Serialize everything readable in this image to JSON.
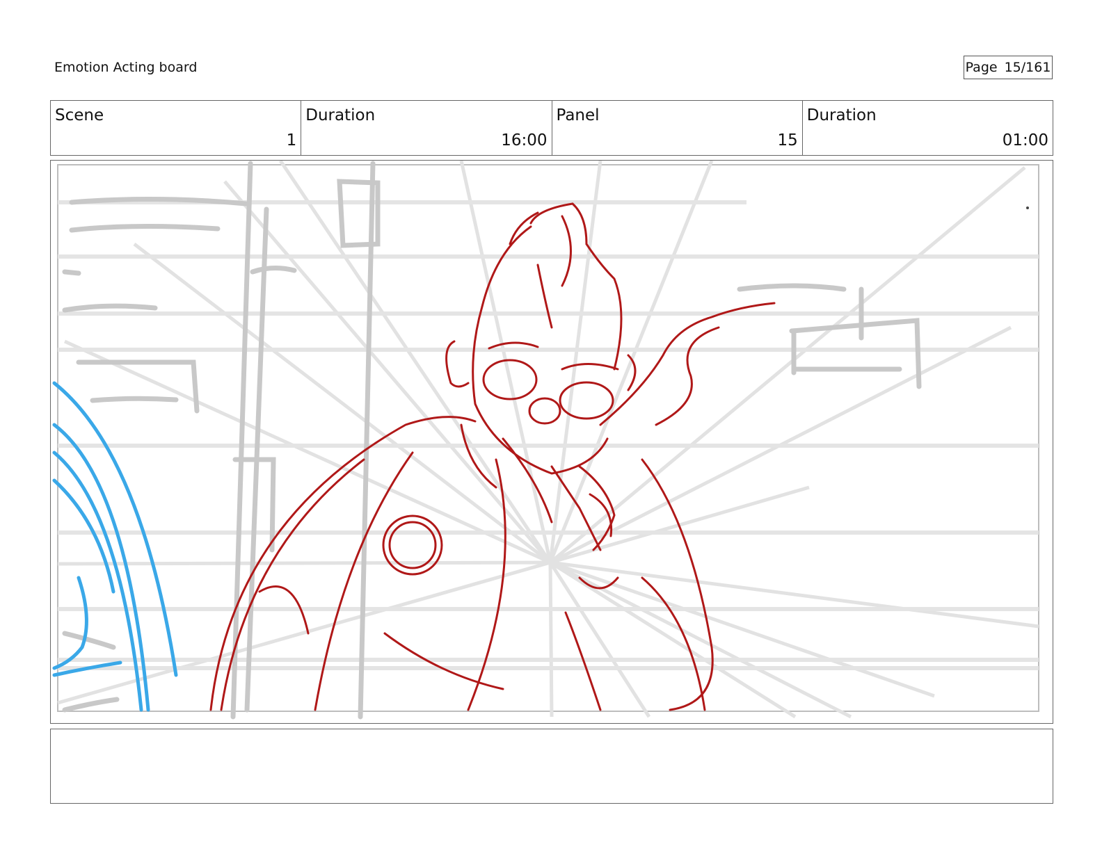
{
  "header": {
    "title": "Emotion Acting board",
    "page_label": "Page",
    "page_number": "15/161"
  },
  "info": {
    "scene_label": "Scene",
    "scene_value": "1",
    "scene_duration_label": "Duration",
    "scene_duration_value": "16:00",
    "panel_label": "Panel",
    "panel_value": "15",
    "panel_duration_label": "Duration",
    "panel_duration_value": "01:00"
  },
  "colors": {
    "character_line": "#b01818",
    "foreground_line": "#3aa8e8",
    "background_line": "#c8c8c8",
    "perspective_line": "#e2e2e2"
  },
  "notes": {
    "text": ""
  }
}
